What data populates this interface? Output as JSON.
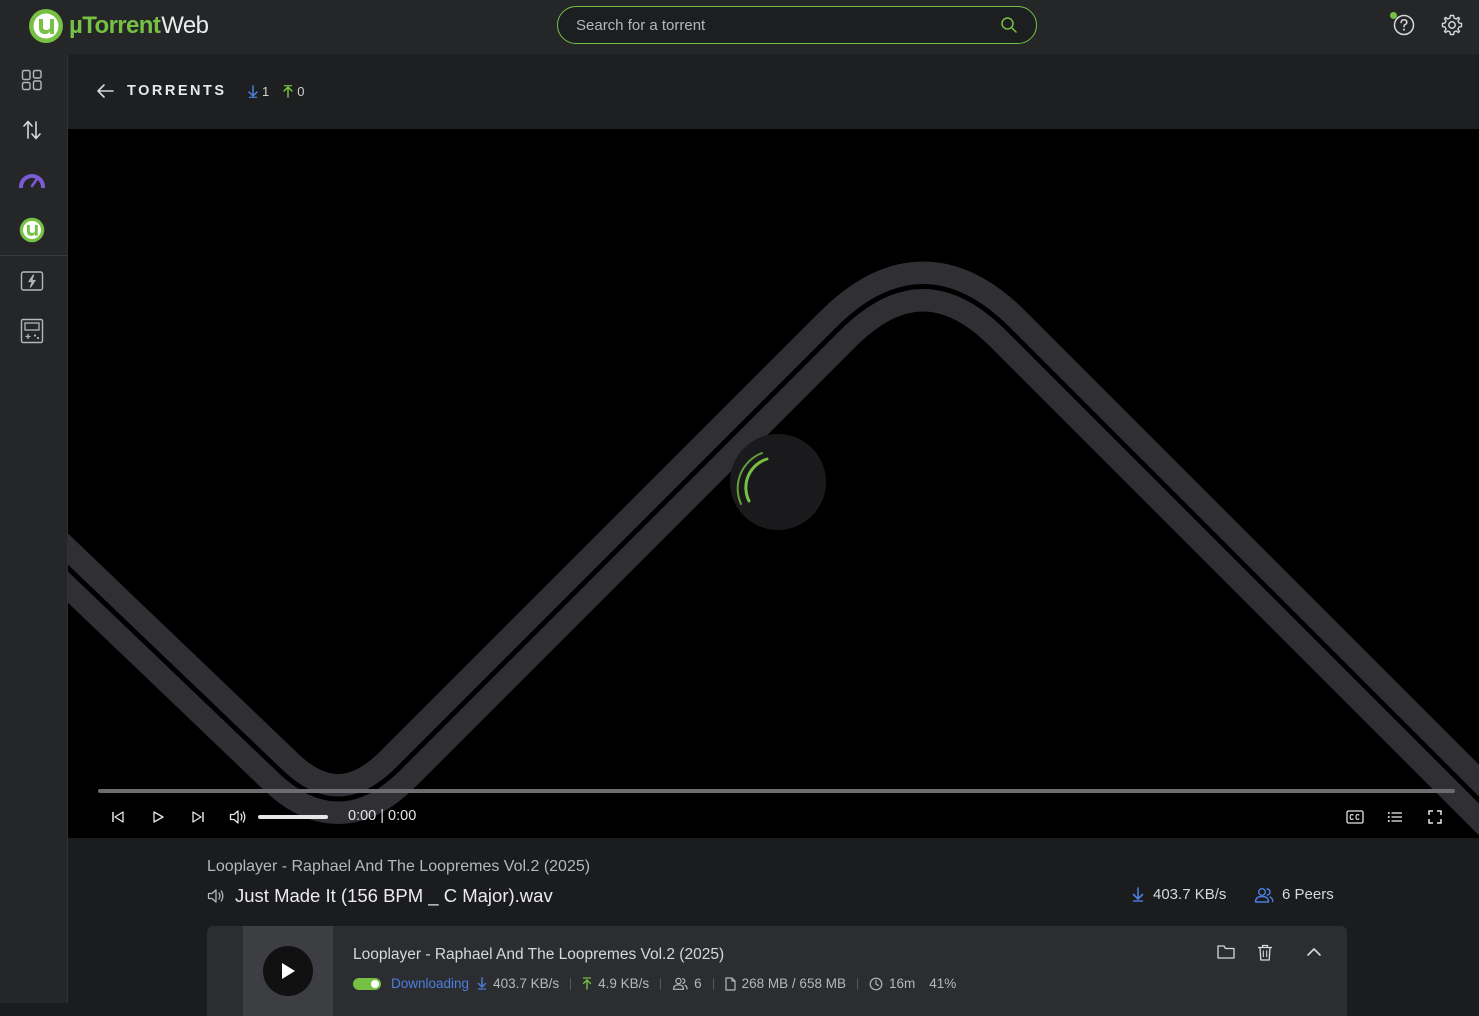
{
  "app": {
    "logo_brand": "µTorrent",
    "logo_suffix": "Web",
    "search_placeholder": "Search for a torrent"
  },
  "sidebar": {
    "items": [
      {
        "icon": "grid-icon"
      },
      {
        "icon": "transfer-arrows-icon"
      },
      {
        "icon": "speedometer-icon",
        "active_color": "#7b5bd6"
      },
      {
        "icon": "utorrent-logo-icon"
      },
      {
        "icon": "lightning-card-icon"
      },
      {
        "icon": "game-console-icon"
      }
    ]
  },
  "subheader": {
    "title": "TORRENTS",
    "down_count": "1",
    "up_count": "0"
  },
  "player": {
    "time": "0:00 | 0:00"
  },
  "now_playing": {
    "album": "Looplayer - Raphael And The Loopremes Vol.2 (2025)",
    "file": "Just Made It (156 BPM _ C Major).wav",
    "download_speed": "403.7 KB/s",
    "peers": "6 Peers"
  },
  "torrent_card": {
    "title": "Looplayer - Raphael And The Loopremes Vol.2 (2025)",
    "status": "Downloading",
    "down_speed": "403.7 KB/s",
    "up_speed": "4.9 KB/s",
    "peers": "6",
    "size": "268 MB / 658 MB",
    "eta": "16m",
    "percent": "41%",
    "progress": 0.41
  },
  "colors": {
    "accent_green": "#76c043",
    "accent_blue": "#4a7fe0",
    "accent_purple": "#7b5bd6"
  }
}
